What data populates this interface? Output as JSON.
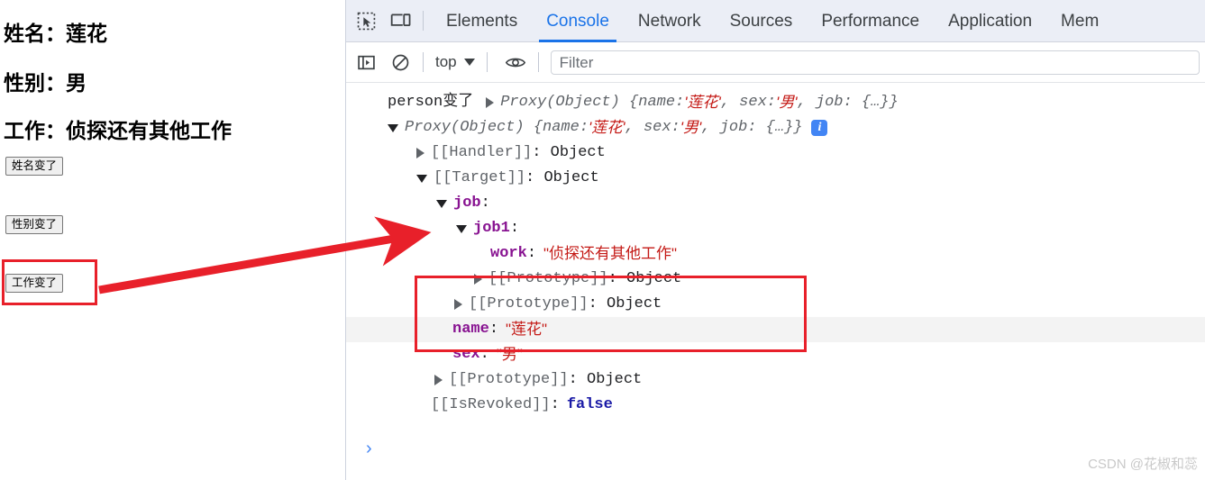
{
  "page": {
    "headings": [
      {
        "label": "姓名：莲花"
      },
      {
        "label": "性别：男"
      },
      {
        "label": "工作：侦探还有其他工作"
      }
    ],
    "buttons": [
      {
        "label": "姓名变了"
      },
      {
        "label": "性别变了"
      },
      {
        "label": "工作变了"
      }
    ]
  },
  "devtools": {
    "icons": {
      "inspect": "inspect-element-icon",
      "device": "device-toolbar-icon",
      "sidebar": "console-sidebar-icon",
      "clear": "clear-console-icon",
      "eye": "live-expression-eye-icon"
    },
    "tabs": [
      {
        "label": "Elements",
        "active": false
      },
      {
        "label": "Console",
        "active": true
      },
      {
        "label": "Network",
        "active": false
      },
      {
        "label": "Sources",
        "active": false
      },
      {
        "label": "Performance",
        "active": false
      },
      {
        "label": "Application",
        "active": false
      },
      {
        "label": "Mem",
        "active": false
      }
    ],
    "context": {
      "label": "top"
    },
    "filter": {
      "placeholder": "Filter",
      "value": ""
    },
    "console": {
      "line1": {
        "message": "person变了",
        "preview_prefix": "Proxy(Object) {name: ",
        "name_value": "'莲花'",
        "mid": ", sex: ",
        "sex_value": "'男'",
        "suffix": ", job: {…}}"
      },
      "line2": {
        "prefix": "Proxy(Object) {name: ",
        "name_value": "'莲花'",
        "mid": ", sex: ",
        "sex_value": "'男'",
        "suffix": ", job: {…}}",
        "badge": "i"
      },
      "handler": {
        "key": "[[Handler]]",
        "value": "Object"
      },
      "target": {
        "key": "[[Target]]",
        "value": "Object"
      },
      "job": {
        "key": "job",
        "colon": ":"
      },
      "job1": {
        "key": "job1",
        "colon": ":"
      },
      "work": {
        "key": "work",
        "colon": ":",
        "value": "\"侦探还有其他工作\""
      },
      "proto_job1": {
        "key": "[[Prototype]]",
        "value": "Object"
      },
      "proto_job": {
        "key": "[[Prototype]]",
        "value": "Object"
      },
      "name": {
        "key": "name",
        "colon": ":",
        "value": "\"莲花\""
      },
      "sex": {
        "key": "sex",
        "colon": ":",
        "value": "\"男\""
      },
      "proto_target": {
        "key": "[[Prototype]]",
        "value": "Object"
      },
      "isrevoked": {
        "key": "[[IsRevoked]]",
        "colon": ":",
        "value": "false"
      },
      "prompt": "›"
    }
  },
  "annotations": {
    "highlight_color": "#e8202a",
    "arrow_color": "#e8202a"
  },
  "watermark": "CSDN @花椒和蕊"
}
